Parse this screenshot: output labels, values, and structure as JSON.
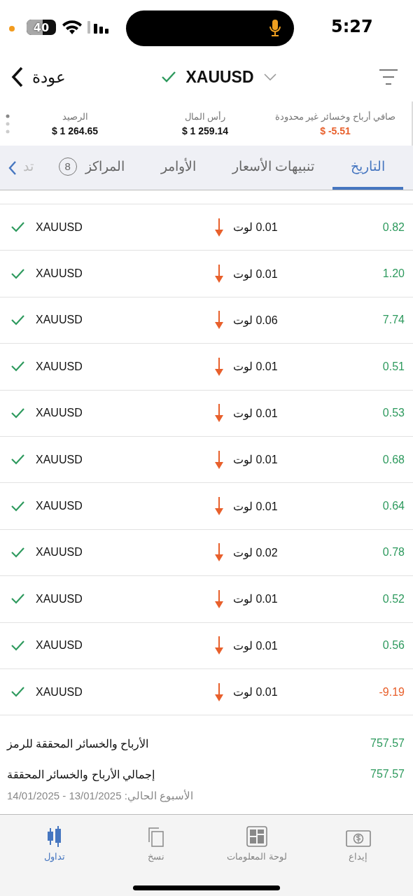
{
  "status_bar": {
    "time": "5:27",
    "battery": "40"
  },
  "header": {
    "back": "عودة",
    "symbol": "XAUUSD"
  },
  "stats": [
    {
      "label": "صافي أرباح وخسائر غير محدودة",
      "value": "$ -5.51",
      "color": "#e8602c"
    },
    {
      "label": "رأس المال",
      "value": "$ 1 259.14",
      "color": "#111111"
    },
    {
      "label": "الرصيد",
      "value": "$ 1 264.65",
      "color": "#111111"
    }
  ],
  "tabs": [
    {
      "label": "التاريخ",
      "selected": true
    },
    {
      "label": "تنبيهات الأسعار",
      "selected": false
    },
    {
      "label": "الأوامر",
      "selected": false
    },
    {
      "label": "المراكز",
      "badge": "8",
      "selected": false
    },
    {
      "label": "تد",
      "selected": false
    }
  ],
  "trades": [
    {
      "symbol": "XAUUSD",
      "lot": "0.01 لوت",
      "profit": "0.82",
      "color": "#2e9a5e"
    },
    {
      "symbol": "XAUUSD",
      "lot": "0.01 لوت",
      "profit": "1.20",
      "color": "#2e9a5e"
    },
    {
      "symbol": "XAUUSD",
      "lot": "0.06 لوت",
      "profit": "7.74",
      "color": "#2e9a5e"
    },
    {
      "symbol": "XAUUSD",
      "lot": "0.01 لوت",
      "profit": "0.51",
      "color": "#2e9a5e"
    },
    {
      "symbol": "XAUUSD",
      "lot": "0.01 لوت",
      "profit": "0.53",
      "color": "#2e9a5e"
    },
    {
      "symbol": "XAUUSD",
      "lot": "0.01 لوت",
      "profit": "0.68",
      "color": "#2e9a5e"
    },
    {
      "symbol": "XAUUSD",
      "lot": "0.01 لوت",
      "profit": "0.64",
      "color": "#2e9a5e"
    },
    {
      "symbol": "XAUUSD",
      "lot": "0.02 لوت",
      "profit": "0.78",
      "color": "#2e9a5e"
    },
    {
      "symbol": "XAUUSD",
      "lot": "0.01 لوت",
      "profit": "0.52",
      "color": "#2e9a5e"
    },
    {
      "symbol": "XAUUSD",
      "lot": "0.01 لوت",
      "profit": "0.56",
      "color": "#2e9a5e"
    },
    {
      "symbol": "XAUUSD",
      "lot": "0.01 لوت",
      "profit": "-9.19",
      "color": "#e8602c"
    }
  ],
  "summary": {
    "rows": [
      {
        "label": "الأرباح والخسائر المحققة للرمز",
        "value": "757.57"
      },
      {
        "label": "إجمالي الأرباح والخسائر المحققة",
        "value": "757.57"
      }
    ],
    "period": "الأسبوع الحالي: 13/01/2025 - 14/01/2025"
  },
  "nav": [
    {
      "label": "إيداع",
      "kind": "deposit",
      "selected": false
    },
    {
      "label": "لوحة المعلومات",
      "kind": "dashboard",
      "selected": false
    },
    {
      "label": "نسخ",
      "kind": "copy",
      "selected": false
    },
    {
      "label": "تداول",
      "kind": "trade",
      "selected": true
    }
  ]
}
